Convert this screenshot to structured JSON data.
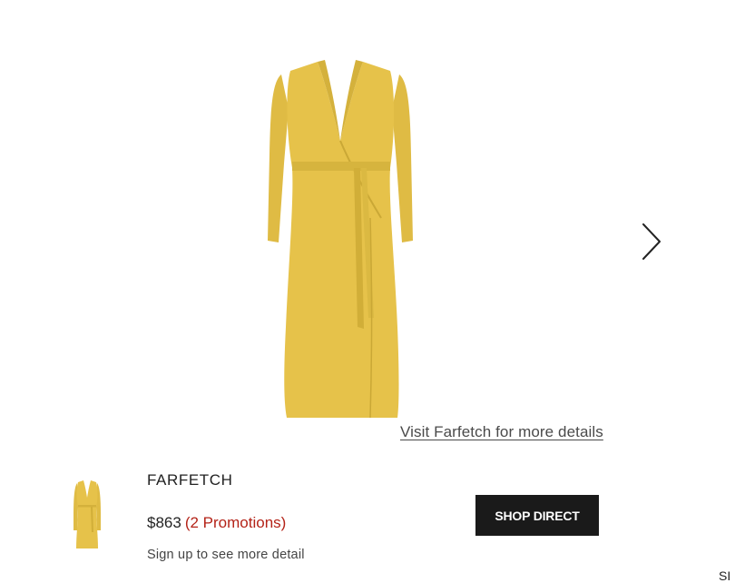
{
  "colors": {
    "dress": "#e6c24a",
    "dress_shadow": "#caa836",
    "button_bg": "#1a1a1a",
    "promo": "#b42318"
  },
  "gallery": {
    "image_icon": "yellow-wrap-dress-image",
    "next_icon": "chevron-right-icon"
  },
  "retailer_link": {
    "label": "Visit Farfetch for more details"
  },
  "offer": {
    "thumbnail_icon": "dress-thumbnail",
    "retailer": "FARFETCH",
    "price": "$863",
    "promotions": "(2 Promotions)",
    "signup": "Sign up to see more detail",
    "button_label": "SHOP DIRECT"
  },
  "next_offer_partial": {
    "text": "SI"
  }
}
